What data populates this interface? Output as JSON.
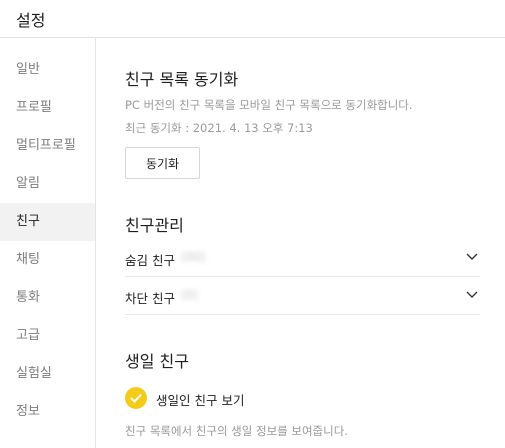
{
  "header": {
    "title": "설정"
  },
  "sidebar": {
    "items": [
      {
        "label": "일반",
        "active": false
      },
      {
        "label": "프로필",
        "active": false
      },
      {
        "label": "멀티프로필",
        "active": false
      },
      {
        "label": "알림",
        "active": false
      },
      {
        "label": "친구",
        "active": true
      },
      {
        "label": "채팅",
        "active": false
      },
      {
        "label": "통화",
        "active": false
      },
      {
        "label": "고급",
        "active": false
      },
      {
        "label": "실험실",
        "active": false
      },
      {
        "label": "정보",
        "active": false
      }
    ]
  },
  "sync": {
    "title": "친구 목록 동기화",
    "description": "PC 버전의 친구 목록을 모바일 친구 목록으로 동기화합니다.",
    "last_sync": "최근 동기화 : 2021. 4. 13 오후 7:13",
    "button_label": "동기화"
  },
  "manage": {
    "title": "친구관리",
    "rows": [
      {
        "label": "숨김 친구",
        "count": "(00)",
        "icon": "chevron-down-icon"
      },
      {
        "label": "차단 친구",
        "count": "(0)",
        "icon": "chevron-down-icon"
      }
    ]
  },
  "birthday": {
    "title": "생일 친구",
    "checkbox_label": "생일인 친구 보기",
    "checked": true,
    "description": "친구 목록에서 친구의 생일 정보를 보여줍니다."
  },
  "colors": {
    "accent": "#f5cb1a",
    "active_bg": "#f2f2f2",
    "muted_text": "#9a9a9a"
  }
}
